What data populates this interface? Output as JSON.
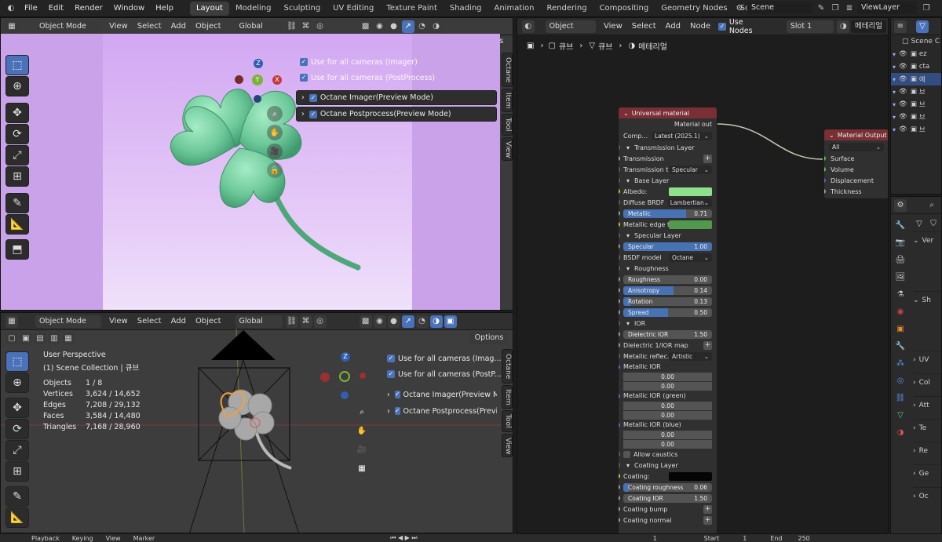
{
  "topbar": {
    "menus": [
      "File",
      "Edit",
      "Render",
      "Window",
      "Help"
    ],
    "workspaces": [
      "Layout",
      "Modeling",
      "Sculpting",
      "UV Editing",
      "Texture Paint",
      "Shading",
      "Animation",
      "Rendering",
      "Compositing",
      "Geometry Nodes",
      "Scripting"
    ],
    "active_workspace": "Layout",
    "add_tab": "+",
    "scene": "Scene",
    "view_layer": "ViewLayer"
  },
  "viewport_top": {
    "mode": "Object Mode",
    "menus": [
      "View",
      "Select",
      "Add",
      "Object"
    ],
    "orientation": "Global",
    "options": "Options",
    "checks": [
      "Use for all cameras (Imager)",
      "Use for all cameras (PostProcess)"
    ],
    "panels": [
      "Octane Imager(Preview Mode)",
      "Octane Postprocess(Preview Mode)"
    ],
    "side_tabs": [
      "Octane",
      "Item",
      "Tool",
      "View"
    ],
    "gizmo": {
      "z": "Z",
      "y": "Y",
      "x": "X"
    }
  },
  "viewport_bottom": {
    "mode": "Object Mode",
    "menus": [
      "View",
      "Select",
      "Add",
      "Object"
    ],
    "orientation": "Global",
    "options": "Options",
    "perspective": "User Perspective",
    "collection": "(1) Scene Collection | 큐브",
    "stats": [
      {
        "label": "Objects",
        "value": "1 / 8"
      },
      {
        "label": "Vertices",
        "value": "3,624 / 14,652"
      },
      {
        "label": "Edges",
        "value": "7,208 / 29,132"
      },
      {
        "label": "Faces",
        "value": "3,584 / 14,480"
      },
      {
        "label": "Triangles",
        "value": "7,168 / 28,960"
      }
    ],
    "checks": [
      "Use for all cameras (Imag...",
      "Use for all cameras (PostP..."
    ],
    "panels": [
      "Octane Imager(Preview Mod",
      "Octane Postprocess(Preview"
    ],
    "side_tabs": [
      "Octane",
      "Item",
      "Tool",
      "View"
    ],
    "gizmo": {
      "z": "Z"
    }
  },
  "timeline": {
    "items": [
      "Playback",
      "Keying",
      "View",
      "Marker"
    ],
    "frame": "1",
    "start_label": "Start",
    "start": "1",
    "end_label": "End",
    "end": "250"
  },
  "node_editor": {
    "type": "Object",
    "menus": [
      "View",
      "Select",
      "Add",
      "Node"
    ],
    "use_nodes": "Use Nodes",
    "slot": "Slot 1",
    "material": "메테리얼",
    "breadcrumb": [
      "큐브",
      "큐브",
      "메테리얼"
    ],
    "universal": {
      "title": "Universal material",
      "output": "Material out",
      "compat_label": "Comp...",
      "compat_value": "Latest (2025.1)",
      "rows": [
        {
          "k": "section",
          "label": "Transmission Layer"
        },
        {
          "k": "plus",
          "label": "Transmission"
        },
        {
          "k": "sel",
          "label": "Transmission t...",
          "value": "Specular"
        },
        {
          "k": "section",
          "label": "Base Layer"
        },
        {
          "k": "color",
          "label": "Albedo:",
          "color": "#8fe08a"
        },
        {
          "k": "sel",
          "label": "Diffuse BRDF ...",
          "value": "Lambertian"
        },
        {
          "k": "slider",
          "label": "Metallic",
          "value": "0.71",
          "fill": 0.71
        },
        {
          "k": "color",
          "label": "Metallic edge t...",
          "color": "#4f9a4d"
        },
        {
          "k": "section",
          "label": "Specular Layer"
        },
        {
          "k": "slider",
          "label": "Specular",
          "value": "1.00",
          "fill": 1.0
        },
        {
          "k": "sel",
          "label": "BSDF model",
          "value": "Octane"
        },
        {
          "k": "section",
          "label": "Roughness"
        },
        {
          "k": "slider",
          "label": "Roughness",
          "value": "0.00",
          "fill": 0.0
        },
        {
          "k": "slider",
          "label": "Anisotropy",
          "value": "0.14",
          "fill": 0.57
        },
        {
          "k": "slider",
          "label": "Rotation",
          "value": "0.13",
          "fill": 0.08
        },
        {
          "k": "slider",
          "label": "Spread",
          "value": "0.50",
          "fill": 0.5
        },
        {
          "k": "section",
          "label": "IOR"
        },
        {
          "k": "slider",
          "label": "Dielectric IOR",
          "value": "1.50",
          "fill": 0.0
        },
        {
          "k": "plus",
          "label": "Dielectric 1/IOR map"
        },
        {
          "k": "sel",
          "label": "Metallic reflec...",
          "value": "Artistic"
        },
        {
          "k": "label",
          "label": "Metallic IOR"
        },
        {
          "k": "num",
          "value": "0.00"
        },
        {
          "k": "num",
          "value": "0.00"
        },
        {
          "k": "label",
          "label": "Metallic IOR (green)"
        },
        {
          "k": "num",
          "value": "0.00"
        },
        {
          "k": "num",
          "value": "0.00"
        },
        {
          "k": "label",
          "label": "Metallic IOR (blue)"
        },
        {
          "k": "num",
          "value": "0.00"
        },
        {
          "k": "num",
          "value": "0.00"
        },
        {
          "k": "check",
          "label": "Allow caustics"
        },
        {
          "k": "section",
          "label": "Coating Layer"
        },
        {
          "k": "color",
          "label": "Coating:",
          "color": "#050505"
        },
        {
          "k": "slider",
          "label": "Coating roughness",
          "value": "0.06",
          "fill": 0.06
        },
        {
          "k": "slider",
          "label": "Coating IOR",
          "value": "1.50",
          "fill": 0.0
        },
        {
          "k": "plus",
          "label": "Coating bump"
        },
        {
          "k": "plus",
          "label": "Coating normal"
        }
      ]
    },
    "output": {
      "title": "Material Output",
      "target": "All",
      "inputs": [
        "Surface",
        "Volume",
        "Displacement",
        "Thickness"
      ]
    }
  },
  "outliner": {
    "scene_label": "Scene C",
    "rows": [
      "ez",
      "cta",
      "에",
      "브",
      "브",
      "브",
      "브"
    ]
  },
  "properties": {
    "sections": [
      "Ver",
      "Sh",
      "UV",
      "Col",
      "Att",
      "Te",
      "Re",
      "Ge",
      "Oc"
    ]
  },
  "colors": {
    "accent": "#4a72b8",
    "node_header": "#7a2f34",
    "output_header": "#7a2f34",
    "viewport_bg": "#d8b5f2"
  }
}
